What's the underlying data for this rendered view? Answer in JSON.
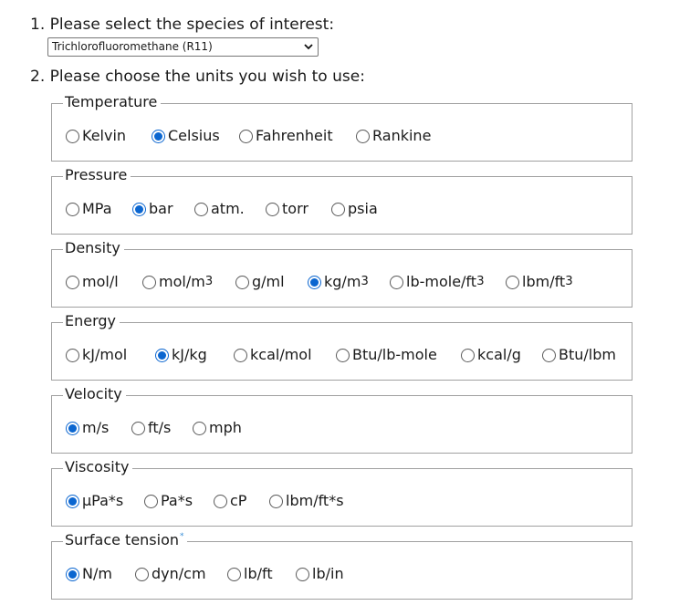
{
  "step1": {
    "label": "1. Please select the species of interest:",
    "selected_species": "Trichlorofluoromethane (R11)"
  },
  "step2": {
    "label": "2. Please choose the units you wish to use:"
  },
  "colors": {
    "accent": "#0b66d0",
    "border": "#a0a0a0",
    "footnote_star": "#3b8fd8"
  },
  "icons": {
    "dropdown": "chevron-down-icon",
    "radio": "radio-button"
  },
  "groups": [
    {
      "key": "temperature",
      "title": "Temperature",
      "footnote": "",
      "options": [
        {
          "label": "Kelvin",
          "sup": "",
          "checked": false
        },
        {
          "label": "Celsius",
          "sup": "",
          "checked": true
        },
        {
          "label": "Fahrenheit",
          "sup": "",
          "checked": false
        },
        {
          "label": "Rankine",
          "sup": "",
          "checked": false
        }
      ]
    },
    {
      "key": "pressure",
      "title": "Pressure",
      "footnote": "",
      "options": [
        {
          "label": "MPa",
          "sup": "",
          "checked": false
        },
        {
          "label": "bar",
          "sup": "",
          "checked": true
        },
        {
          "label": "atm.",
          "sup": "",
          "checked": false
        },
        {
          "label": "torr",
          "sup": "",
          "checked": false
        },
        {
          "label": "psia",
          "sup": "",
          "checked": false
        }
      ]
    },
    {
      "key": "density",
      "title": "Density",
      "footnote": "",
      "options": [
        {
          "label": "mol/l",
          "sup": "",
          "checked": false
        },
        {
          "label": "mol/m",
          "sup": "3",
          "checked": false
        },
        {
          "label": "g/ml",
          "sup": "",
          "checked": false
        },
        {
          "label": "kg/m",
          "sup": "3",
          "checked": true
        },
        {
          "label": "lb-mole/ft",
          "sup": "3",
          "checked": false
        },
        {
          "label": "lbm/ft",
          "sup": "3",
          "checked": false
        }
      ]
    },
    {
      "key": "energy",
      "title": "Energy",
      "footnote": "",
      "options": [
        {
          "label": "kJ/mol",
          "sup": "",
          "checked": false
        },
        {
          "label": "kJ/kg",
          "sup": "",
          "checked": true
        },
        {
          "label": "kcal/mol",
          "sup": "",
          "checked": false
        },
        {
          "label": "Btu/lb-mole",
          "sup": "",
          "checked": false
        },
        {
          "label": "kcal/g",
          "sup": "",
          "checked": false
        },
        {
          "label": "Btu/lbm",
          "sup": "",
          "checked": false
        }
      ]
    },
    {
      "key": "velocity",
      "title": "Velocity",
      "footnote": "",
      "options": [
        {
          "label": "m/s",
          "sup": "",
          "checked": true
        },
        {
          "label": "ft/s",
          "sup": "",
          "checked": false
        },
        {
          "label": "mph",
          "sup": "",
          "checked": false
        }
      ]
    },
    {
      "key": "viscosity",
      "title": "Viscosity",
      "footnote": "",
      "options": [
        {
          "label": "μPa*s",
          "sup": "",
          "checked": true
        },
        {
          "label": "Pa*s",
          "sup": "",
          "checked": false
        },
        {
          "label": "cP",
          "sup": "",
          "checked": false
        },
        {
          "label": "lbm/ft*s",
          "sup": "",
          "checked": false
        }
      ]
    },
    {
      "key": "surface-tension",
      "title": "Surface tension",
      "footnote": "*",
      "options": [
        {
          "label": "N/m",
          "sup": "",
          "checked": true
        },
        {
          "label": "dyn/cm",
          "sup": "",
          "checked": false
        },
        {
          "label": "lb/ft",
          "sup": "",
          "checked": false
        },
        {
          "label": "lb/in",
          "sup": "",
          "checked": false
        }
      ]
    }
  ]
}
